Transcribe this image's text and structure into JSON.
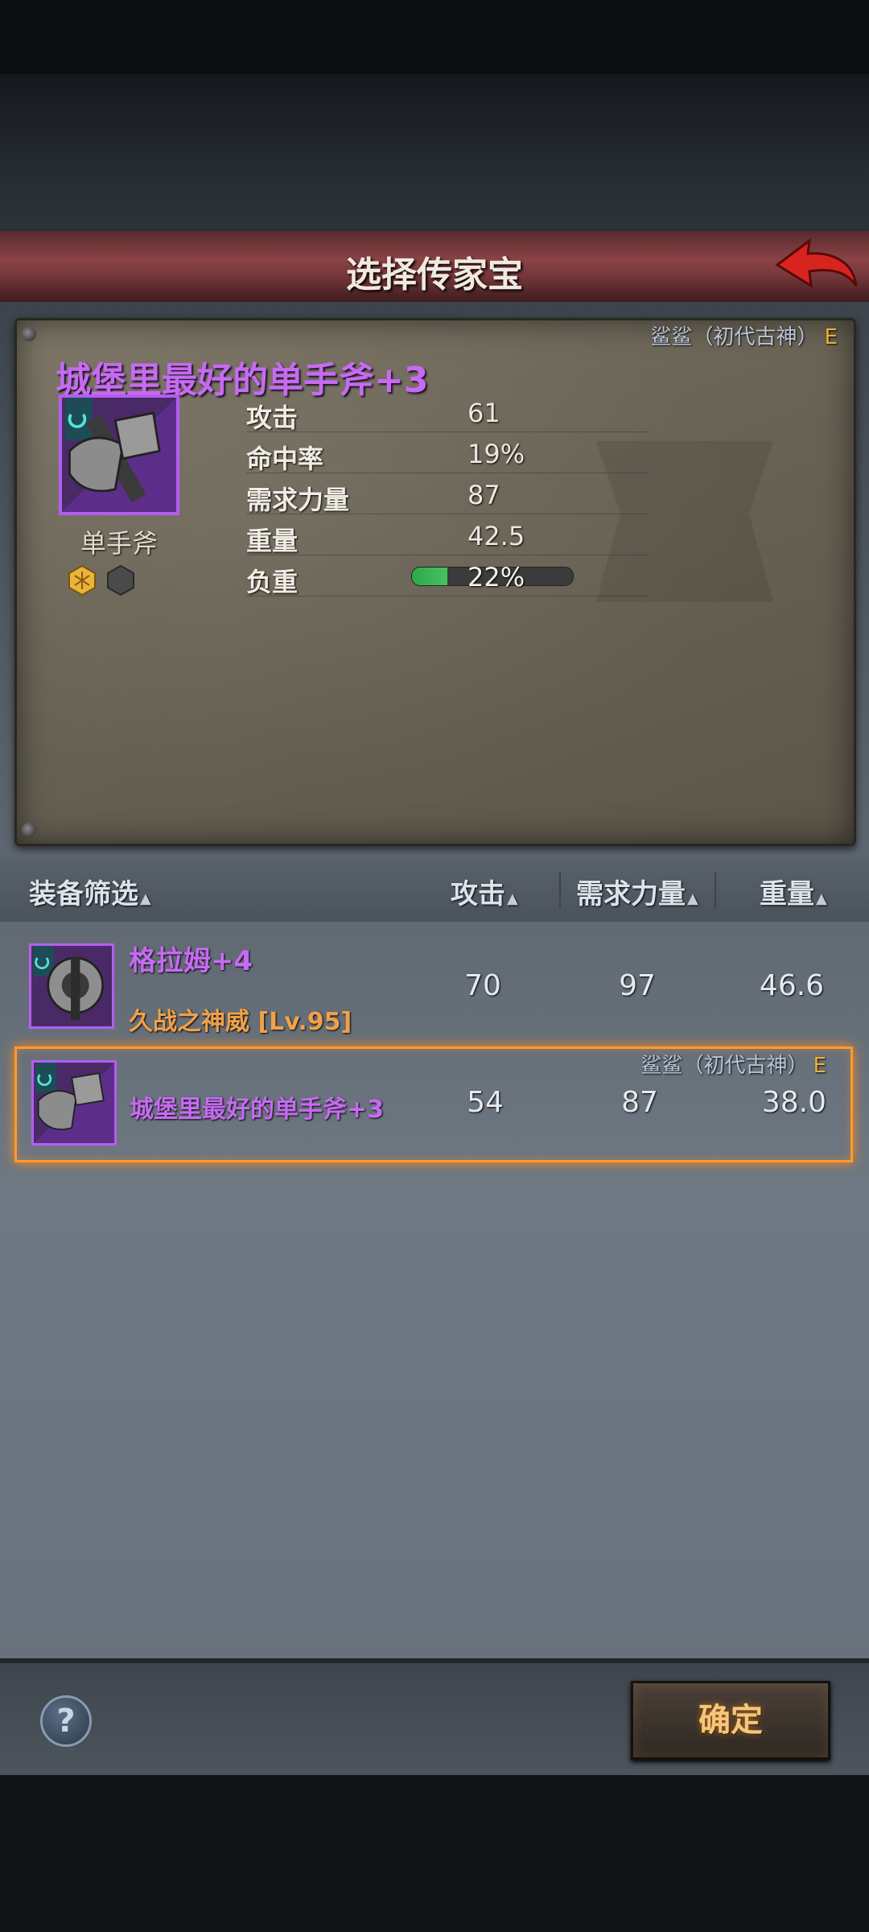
{
  "header": {
    "title": "选择传家宝"
  },
  "detail": {
    "equipped_by": "鲨鲨（初代古神）",
    "grade": "E",
    "item_name": "城堡里最好的单手斧+3",
    "item_type": "单手斧",
    "stats": [
      {
        "label": "攻击",
        "value": "61"
      },
      {
        "label": "命中率",
        "value": "19%"
      },
      {
        "label": "需求力量",
        "value": "87"
      },
      {
        "label": "重量",
        "value": "42.5"
      }
    ],
    "load": {
      "label": "负重",
      "value": "22%",
      "fraction": 0.22
    }
  },
  "filter": {
    "title": "装备筛选",
    "columns": [
      "攻击",
      "需求力量",
      "重量"
    ]
  },
  "items": [
    {
      "name": "格拉姆+4",
      "sub": "久战之神威",
      "level": "[Lv.95]",
      "attack": "70",
      "strength": "97",
      "weight": "46.6"
    },
    {
      "name": "城堡里最好的单手斧+3",
      "owner": "鲨鲨（初代古神）",
      "grade": "E",
      "attack": "54",
      "strength": "87",
      "weight": "38.0"
    }
  ],
  "footer": {
    "help": "?",
    "confirm": "确定"
  },
  "colors": {
    "accent_purple": "#c76af2",
    "selection_orange": "#ff9a2e",
    "grade_yellow": "#f0b030"
  }
}
